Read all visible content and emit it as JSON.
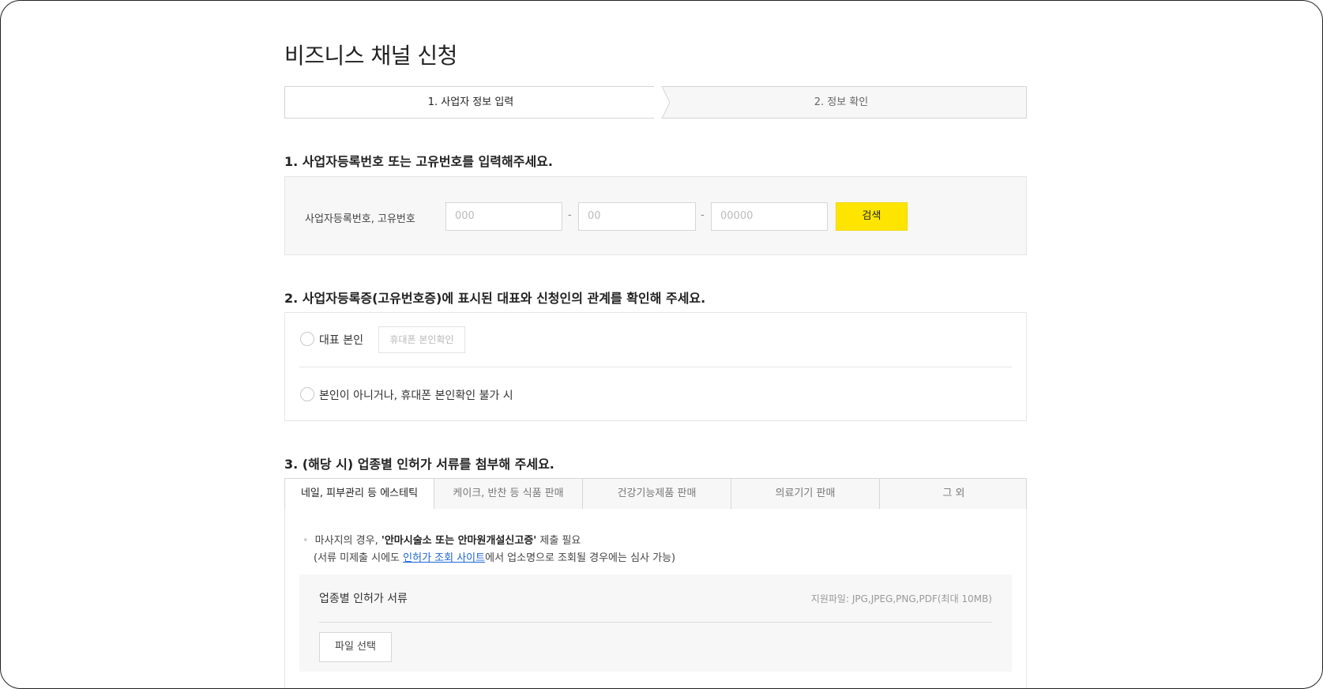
{
  "page": {
    "title": "비즈니스 채널 신청"
  },
  "steps": [
    {
      "label": "1. 사업자 정보 입력"
    },
    {
      "label": "2. 정보 확인"
    }
  ],
  "section1": {
    "title": "1. 사업자등록번호 또는 고유번호를 입력해주세요.",
    "field_label": "사업자등록번호, 고유번호",
    "input1_placeholder": "000",
    "input2_placeholder": "00",
    "input3_placeholder": "00000",
    "separator": "-",
    "search_label": "검색"
  },
  "section2": {
    "title": "2. 사업자등록증(고유번호증)에 표시된 대표와 신청인의 관계를 확인해 주세요.",
    "option1_label": "대표 본인",
    "phone_verify_label": "휴대폰 본인확인",
    "option2_label": "본인이 아니거나, 휴대폰 본인확인 불가 시"
  },
  "section3": {
    "title": "3. (해당 시) 업종별 인허가 서류를 첨부해 주세요.",
    "tabs": [
      {
        "label": "네일, 피부관리 등 에스테틱"
      },
      {
        "label": "케이크, 반찬 등 식품 판매"
      },
      {
        "label": "건강기능제품 판매"
      },
      {
        "label": "의료기기 판매"
      },
      {
        "label": "그 외"
      }
    ],
    "note1_prefix": "마사지의 경우, ",
    "note1_bold": "'안마시술소 또는 안마원개설신고증'",
    "note1_suffix": " 제출 필요",
    "note2_prefix": "(서류 미제출 시에도 ",
    "note2_link": "인허가 조회 사이트",
    "note2_suffix": "에서 업소명으로 조회될 경우에는 심사 가능)",
    "upload_title": "업종별 인허가 서류",
    "upload_hint": "지원파일: JPG,JPEG,PNG,PDF(최대 10MB)",
    "file_button_label": "파일 선택"
  },
  "colors": {
    "accent": "#fee500",
    "link": "#1c65d3"
  }
}
